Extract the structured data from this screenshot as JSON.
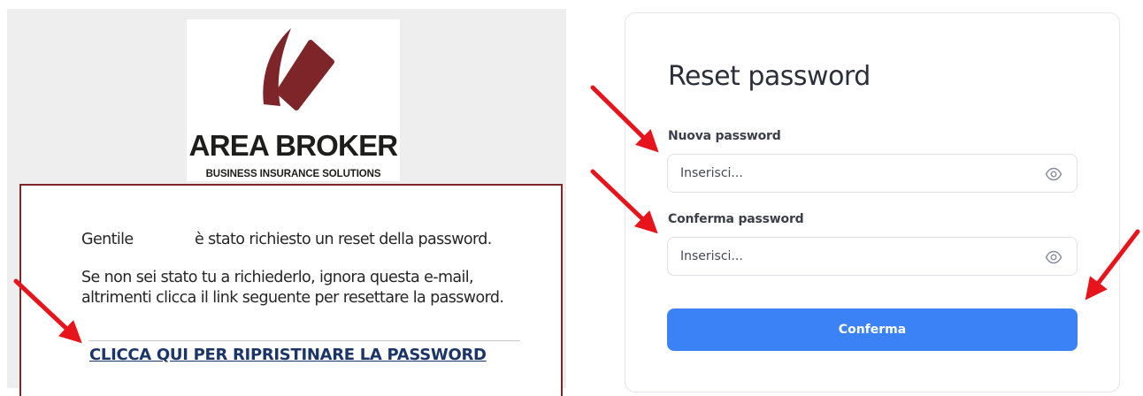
{
  "email": {
    "logo": {
      "title": "AREA BROKER",
      "subtitle": "BUSINESS INSURANCE SOLUTIONS"
    },
    "greeting_word": "Gentile",
    "greeting_rest": "è stato richiesto un reset della password.",
    "paragraph": "Se non sei stato tu a richiederlo, ignora questa e-mail, altrimenti clicca il link seguente per resettare la password.",
    "reset_link": "CLICCA QUI PER RIPRISTINARE LA PASSWORD"
  },
  "form": {
    "title": "Reset password",
    "new_password": {
      "label": "Nuova password",
      "placeholder": "Inserisci..."
    },
    "confirm_password": {
      "label": "Conferma password",
      "placeholder": "Inserisci..."
    },
    "submit_label": "Conferma"
  },
  "icons": {
    "password_toggle": "eye-icon",
    "annotation": "red-arrow-icon"
  },
  "colors": {
    "brand_red": "#7d2528",
    "link": "#1c3568",
    "primary_button": "#3b82f6",
    "annotation_arrow": "#e8141b"
  }
}
